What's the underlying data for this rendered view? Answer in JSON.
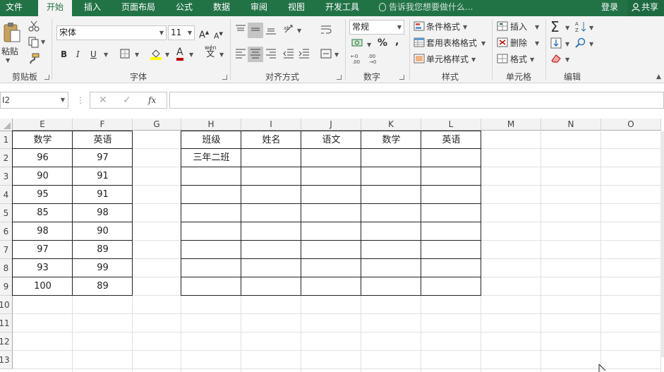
{
  "tabs": [
    {
      "label": "文件",
      "active": false
    },
    {
      "label": "开始",
      "active": true
    },
    {
      "label": "插入",
      "active": false
    },
    {
      "label": "页面布局",
      "active": false
    },
    {
      "label": "公式",
      "active": false
    },
    {
      "label": "数据",
      "active": false
    },
    {
      "label": "审阅",
      "active": false
    },
    {
      "label": "视图",
      "active": false
    },
    {
      "label": "开发工具",
      "active": false
    }
  ],
  "tell_me": "告诉我您想要做什么...",
  "login": "登录",
  "share": "共享",
  "ribbon": {
    "clipboard": {
      "paste": "粘贴",
      "label": "剪贴板"
    },
    "font": {
      "name": "宋体",
      "size": "11",
      "bold": "B",
      "italic": "I",
      "underline": "U",
      "font_color_glyph": "A",
      "wen": "wén",
      "wen_char": "文",
      "label": "字体"
    },
    "alignment": {
      "label": "对齐方式"
    },
    "number": {
      "format": "常规",
      "percent": "%",
      "comma": ",",
      "label": "数字"
    },
    "styles": {
      "conditional": "条件格式",
      "table": "套用表格格式",
      "cell_style": "单元格样式",
      "label": "样式"
    },
    "cells": {
      "insert": "插入",
      "delete": "删除",
      "format": "格式",
      "label": "单元格"
    },
    "editing": {
      "label": "编辑"
    }
  },
  "formula_bar": {
    "name_box": "I2",
    "fx": "fx",
    "cancel": "✕",
    "confirm": "✓",
    "value": ""
  },
  "columns": [
    "E",
    "F",
    "G",
    "H",
    "I",
    "J",
    "K",
    "L",
    "M",
    "N",
    "O"
  ],
  "rows": [
    "1",
    "2",
    "3",
    "4",
    "5",
    "6",
    "7",
    "8",
    "9",
    "10",
    "11",
    "12",
    "13"
  ],
  "table1": {
    "headers": [
      "数学",
      "英语"
    ],
    "rows": [
      [
        "96",
        "97"
      ],
      [
        "90",
        "91"
      ],
      [
        "95",
        "91"
      ],
      [
        "85",
        "98"
      ],
      [
        "98",
        "90"
      ],
      [
        "97",
        "89"
      ],
      [
        "93",
        "99"
      ],
      [
        "100",
        "89"
      ]
    ]
  },
  "table2": {
    "headers": [
      "班级",
      "姓名",
      "语文",
      "数学",
      "英语"
    ],
    "first_cell": "三年二班"
  },
  "colors": {
    "excel_green": "#217346",
    "ribbon_bg": "#f3f3f3",
    "gridline": "#e1e1e1"
  }
}
